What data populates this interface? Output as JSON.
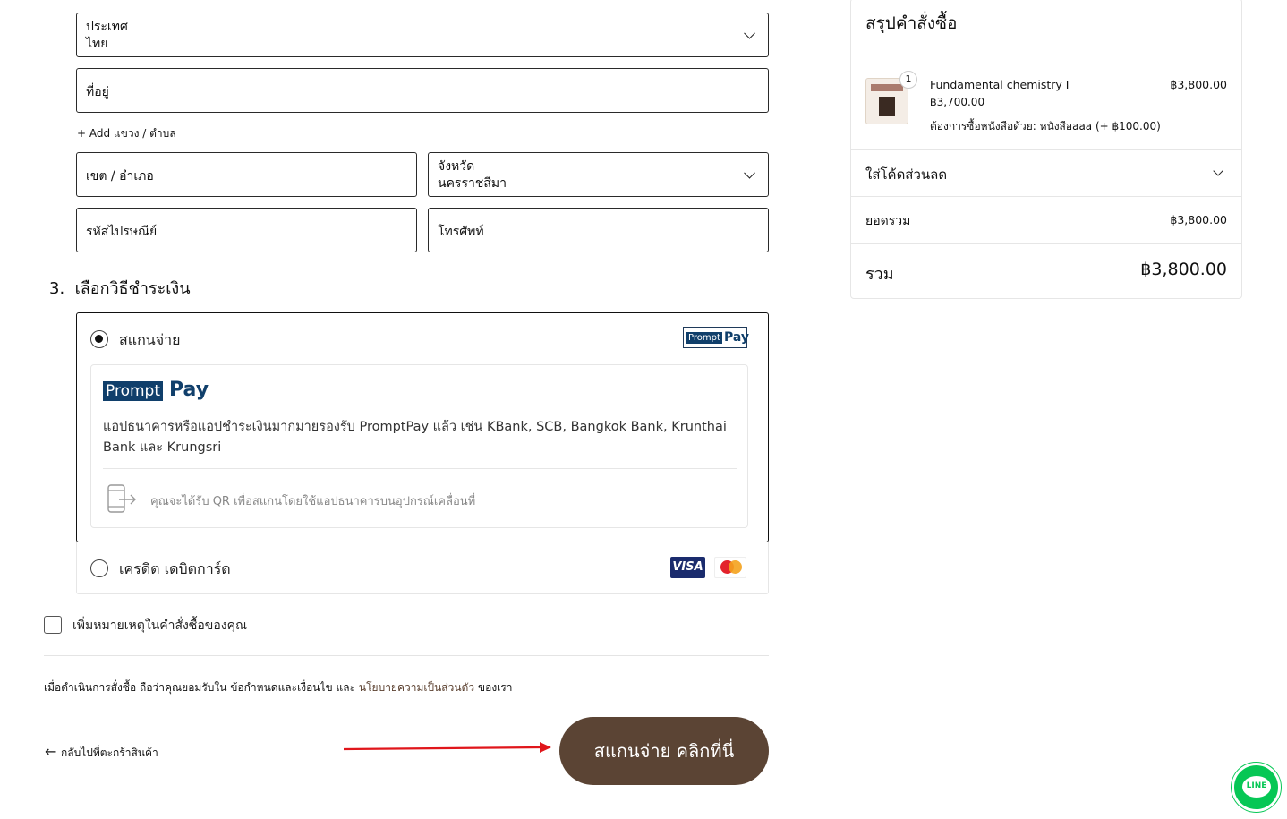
{
  "form": {
    "country_label": "ประเทศ",
    "country_value": "ไทย",
    "address_placeholder": "ที่อยู่",
    "add_subdistrict_link": "+ Add แขวง / ตำบล",
    "district_placeholder": "เขต / อำเภอ",
    "province_label": "จังหวัด",
    "province_value": "นครราชสีมา",
    "postal_placeholder": "รหัสไปรษณีย์",
    "phone_placeholder": "โทรศัพท์"
  },
  "payment": {
    "section_title": "3.  เลือกวิธีชำระเงิน",
    "scan_label": "สแกนจ่าย",
    "promptpay_badge_left": "Prompt",
    "promptpay_badge_right": "Pay",
    "promptpay_logo_left": "Prompt",
    "promptpay_logo_right": "Pay",
    "description": "แอปธนาคารหรือแอปชำระเงินมากมายรองรับ PromptPay แล้ว เช่น KBank, SCB, Bangkok Bank, Krunthai Bank และ Krungsri",
    "qr_note": "คุณจะได้รับ QR เพื่อสแกนโดยใช้แอปธนาคารบนอุปกรณ์เคลื่อนที่",
    "card_label": "เครดิต เดบิตการ์ด",
    "visa_text": "VISA",
    "selected": "scan"
  },
  "order_note": {
    "label": "เพิ่มหมายเหตุในคำสั่งซื้อของคุณ",
    "checked": false
  },
  "terms": {
    "prefix": "เมื่อดำเนินการสั่งซื้อ ถือว่าคุณยอมรับใน ข้อกำหนดและเงื่อนไข และ ",
    "policy_link": "นโยบายความเป็นส่วนตัว",
    "suffix": " ของเรา"
  },
  "actions": {
    "back_label": "กลับไปที่ตะกร้าสินค้า",
    "pay_button": "สแกนจ่าย คลิกที่นี่"
  },
  "summary": {
    "title": "สรุปคำสั่งซื้อ",
    "item": {
      "quantity": "1",
      "name": "Fundamental chemistry I",
      "base_price": "฿3,700.00",
      "option": "ต้องการซื้อหนังสือด้วย: หนังสือaaa (+ ฿100.00)",
      "price": "฿3,800.00"
    },
    "discount_label": "ใส่โค้ดส่วนลด",
    "subtotal_label": "ยอดรวม",
    "subtotal_value": "฿3,800.00",
    "total_label": "รวม",
    "total_value": "฿3,800.00"
  },
  "chat": {
    "line_label": "LINE"
  },
  "colors": {
    "primary_button": "#5b4434",
    "promptpay_blue": "#103f6b",
    "line_green": "#06c755",
    "arrow_red": "#e0161b"
  }
}
